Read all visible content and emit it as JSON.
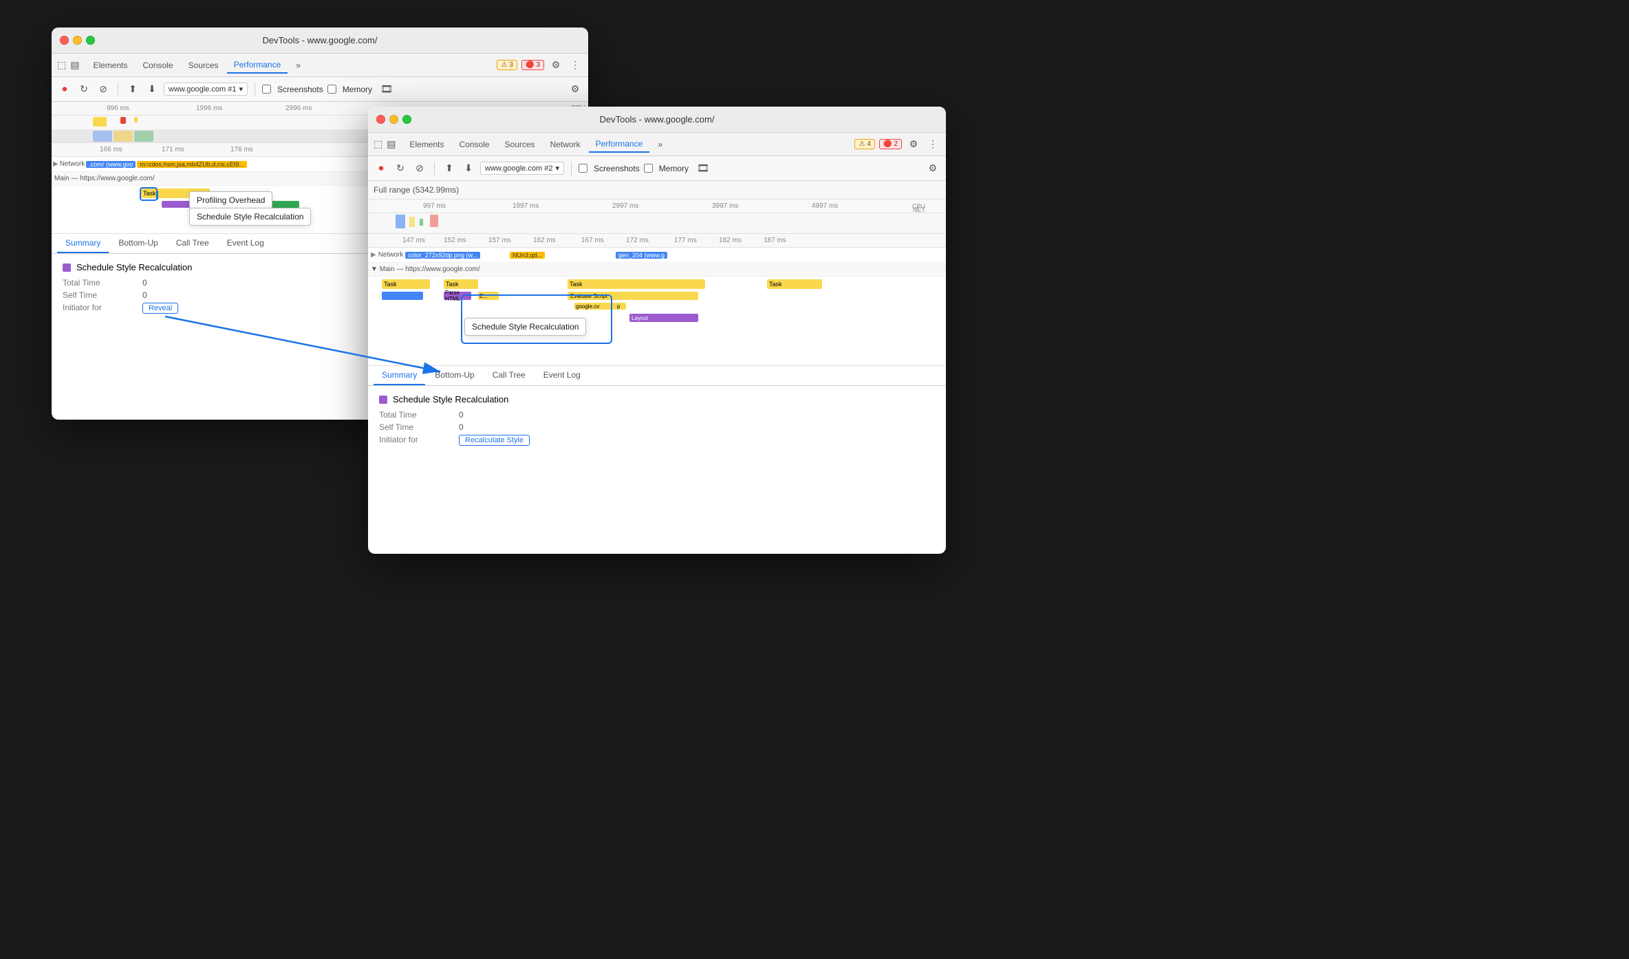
{
  "window_back": {
    "title": "DevTools - www.google.com/",
    "tabs": [
      "Elements",
      "Console",
      "Sources",
      "Performance",
      "»"
    ],
    "active_tab": "Performance",
    "warnings": "3",
    "errors": "3",
    "perf_controls": {
      "record": "⏺",
      "reload": "↻",
      "clear": "⊘",
      "upload": "↑",
      "download": "↓",
      "target": "www.google.com #1",
      "screenshots_label": "Screenshots",
      "memory_label": "Memory"
    },
    "timeline": {
      "ruler_marks": [
        "996 ms",
        "1996 ms",
        "2996 ms"
      ],
      "time_marks": [
        "166 ms",
        "171 ms",
        "176 ms"
      ],
      "network_label": "Network",
      "network_url": ".com/ (www.goo",
      "network_url2": "m=cdos,hsm,jsa,mb4ZUb,d,csi,cEt9...",
      "main_label": "Main — https://www.google.com/",
      "task_label": "Task"
    },
    "profiling_tooltip": "Profiling Overhead",
    "schedule_tooltip": "Schedule Style Recalculation",
    "summary": {
      "tabs": [
        "Summary",
        "Bottom-Up",
        "Call Tree",
        "Event Log"
      ],
      "active_tab": "Summary",
      "event_name": "Schedule Style Recalculation",
      "total_time_label": "Total Time",
      "total_time_value": "0",
      "self_time_label": "Self Time",
      "self_time_value": "0",
      "initiator_label": "Initiator for",
      "initiator_link": "Reveal"
    }
  },
  "window_front": {
    "title": "DevTools - www.google.com/",
    "tabs": [
      "Elements",
      "Console",
      "Sources",
      "Network",
      "Performance",
      "»"
    ],
    "active_tab": "Performance",
    "warnings": "4",
    "errors": "2",
    "perf_controls": {
      "target": "www.google.com #2",
      "screenshots_label": "Screenshots",
      "memory_label": "Memory"
    },
    "full_range": "Full range (5342.99ms)",
    "timeline": {
      "ruler_marks": [
        "997 ms",
        "1997 ms",
        "2997 ms",
        "3997 ms",
        "4997 ms"
      ],
      "time_marks": [
        "147 ms",
        "152 ms",
        "157 ms",
        "162 ms",
        "167 ms",
        "172 ms",
        "177 ms",
        "182 ms",
        "187 ms"
      ],
      "network_label": "Network",
      "network_url": "color_272x92dp.png (w...",
      "network_url2": "NUn3,qd...",
      "network_url3": "gen_204 (www.g",
      "main_label": "Main — https://www.google.com/",
      "tasks": [
        "Task",
        "Task",
        "Task",
        "Task"
      ],
      "subtasks": [
        "Parse HTML",
        "E...",
        "Evaluate Script",
        "google.cv",
        "p",
        "Layout"
      ]
    },
    "schedule_tooltip": "Schedule Style Recalculation",
    "summary": {
      "tabs": [
        "Summary",
        "Bottom-Up",
        "Call Tree",
        "Event Log"
      ],
      "active_tab": "Summary",
      "event_name": "Schedule Style Recalculation",
      "total_time_label": "Total Time",
      "total_time_value": "0",
      "self_time_label": "Self Time",
      "self_time_value": "0",
      "initiator_label": "Initiator for",
      "initiator_link": "Recalculate Style"
    }
  },
  "icons": {
    "record": "⏺",
    "reload": "↻",
    "clear": "⊘",
    "upload": "⬆",
    "download": "⬇",
    "screenshot": "📷",
    "settings": "⚙",
    "more": "⋮",
    "dropdown": "▾",
    "warning": "⚠",
    "error": "🔴",
    "pause": "⏸",
    "sidebar": "▤",
    "inspect": "⬚"
  }
}
